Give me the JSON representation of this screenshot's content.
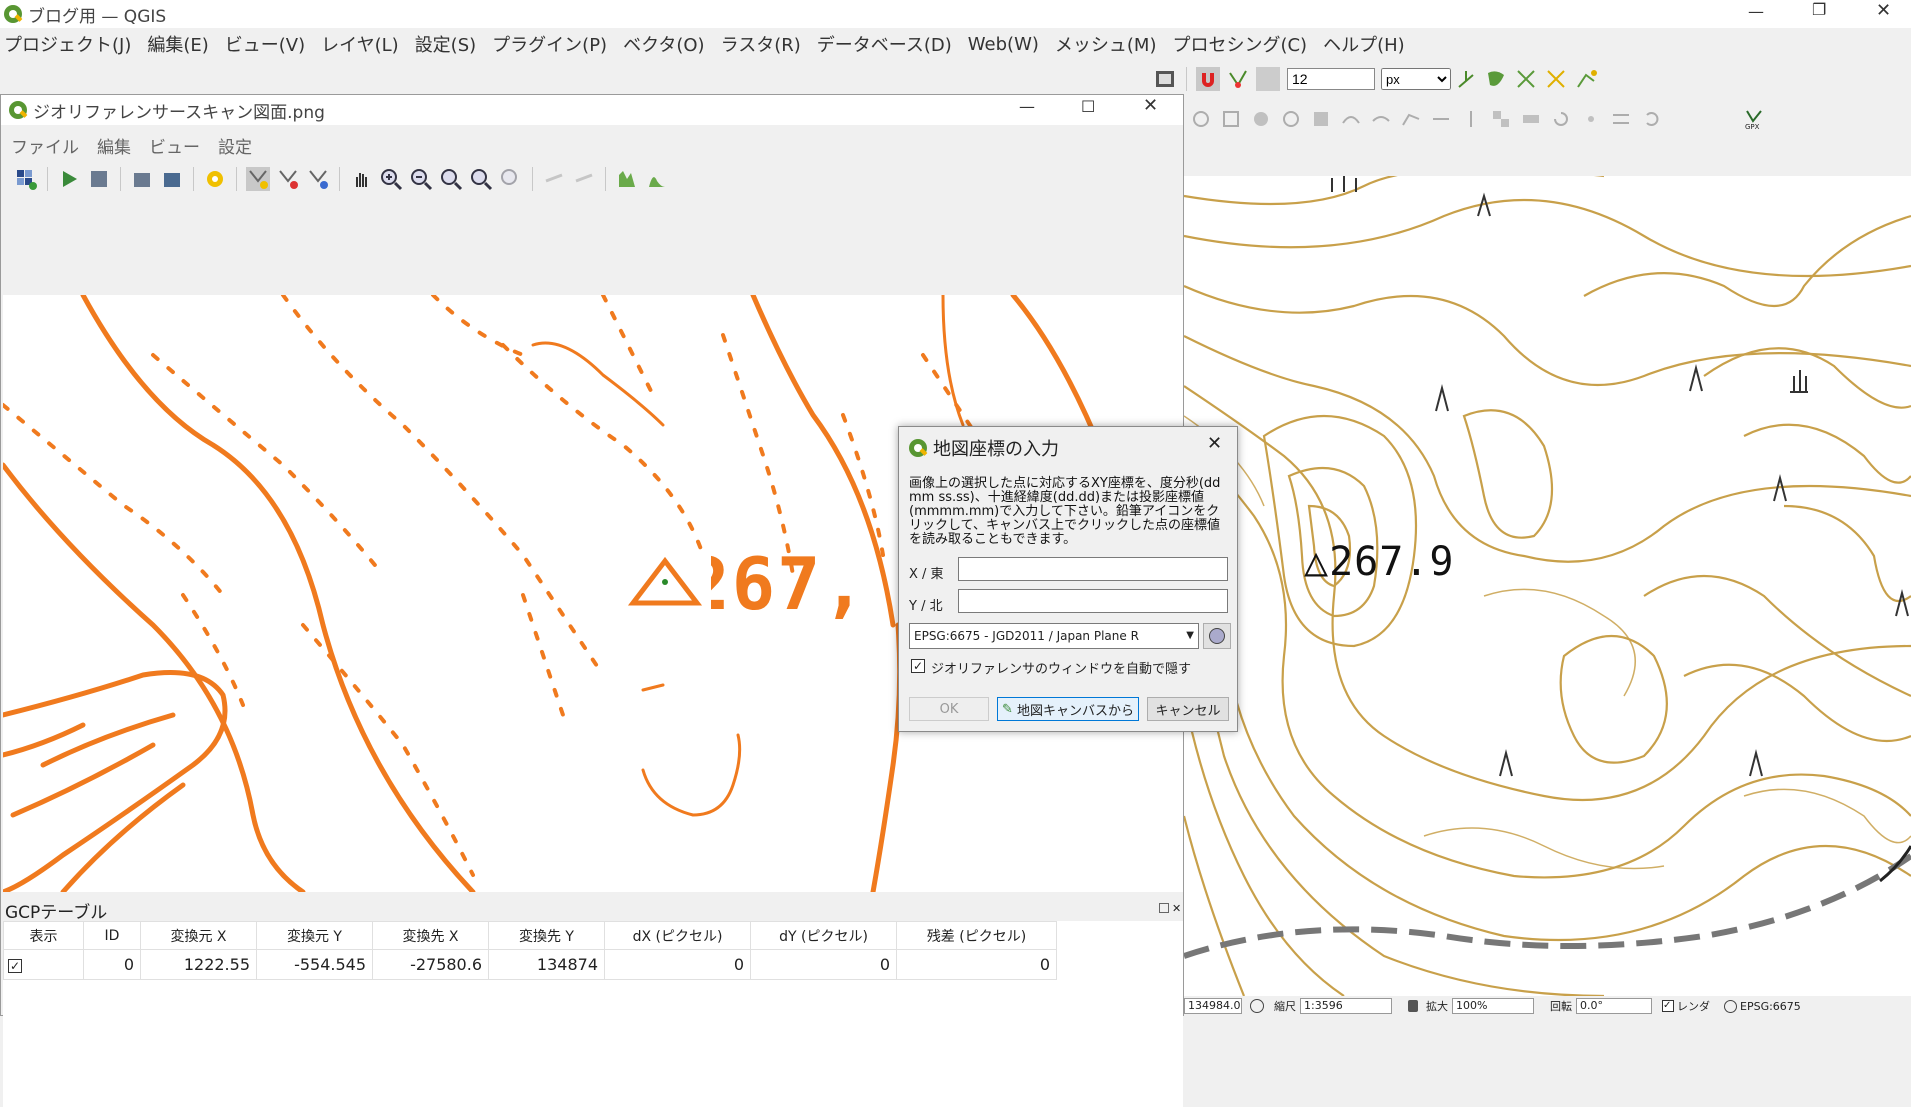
{
  "main_window": {
    "title": "ブログ用 — QGIS",
    "menu": [
      "プロジェクト(J)",
      "編集(E)",
      "ビュー(V)",
      "レイヤ(L)",
      "設定(S)",
      "プラグイン(P)",
      "ベクタ(O)",
      "ラスタ(R)",
      "データベース(D)",
      "Web(W)",
      "メッシュ(M)",
      "プロセシング(C)",
      "ヘルプ(H)"
    ],
    "snap_tolerance": "12",
    "snap_unit": "px"
  },
  "georef": {
    "title": "ジオリファレンサースキャン図面.png",
    "menu": [
      "ファイル",
      "編集",
      "ビュー",
      "設定"
    ],
    "map_label": "△267,",
    "gcp_title": "GCPテーブル",
    "columns": [
      "表示",
      "ID",
      "変換元 X",
      "変換元 Y",
      "変換先 X",
      "変換先 Y",
      "dX (ピクセル)",
      "dY (ピクセル)",
      "残差 (ピクセル)"
    ],
    "rows": [
      [
        "✓",
        "0",
        "1222.55",
        "-554.545",
        "-27580.6",
        "134874",
        "0",
        "0",
        "0"
      ]
    ]
  },
  "dialog": {
    "title": "地図座標の入力",
    "description": "画像上の選択した点に対応するXY座標を、度分秒(dd mm ss.ss)、十進経緯度(dd.dd)または投影座標値(mmmm.mm)で入力して下さい。鉛筆アイコンをクリックして、キャンバス上でクリックした点の座標値を読み取ることもできます。",
    "x_label": "X / 東",
    "y_label": "Y / 北",
    "x_value": "",
    "y_value": "",
    "crs": "EPSG:6675 - JGD2011 / Japan Plane R",
    "autohide_label": "ジオリファレンサのウィンドウを自動で隠す",
    "ok": "OK",
    "from_canvas": "地図キャンバスから",
    "cancel": "キャンセル"
  },
  "right_map": {
    "label": "△267.9"
  },
  "status": {
    "coordinate": "134984.0",
    "scale_label": "縮尺",
    "scale": "1:3596",
    "magnify_label": "拡大",
    "magnify": "100%",
    "rotation_label": "回転",
    "rotation": "0.0°",
    "render_label": "レンダ",
    "crs": "EPSG:6675"
  },
  "colors": {
    "scan_contour": "#f07a1e",
    "map_contour": "#c8a04a",
    "qgis_green": "#589632"
  }
}
